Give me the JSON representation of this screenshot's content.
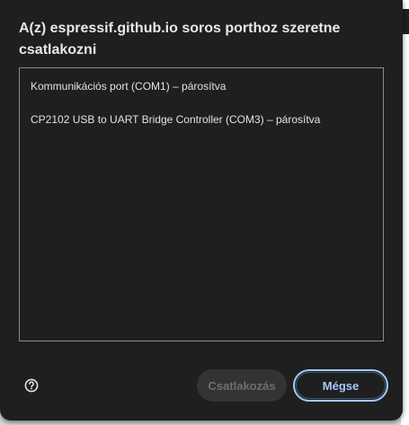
{
  "dialog": {
    "title": "A(z) espressif.github.io soros porthoz szeretne csatlakozni",
    "ports": [
      {
        "label": "Kommunikációs port (COM1) – párosítva"
      },
      {
        "label": "CP2102 USB to UART Bridge Controller (COM3) – párosítva"
      }
    ],
    "help_icon": "question-circle-icon",
    "connect_label": "Csatlakozás",
    "cancel_label": "Mégse",
    "accent": "#a8c7fa"
  }
}
